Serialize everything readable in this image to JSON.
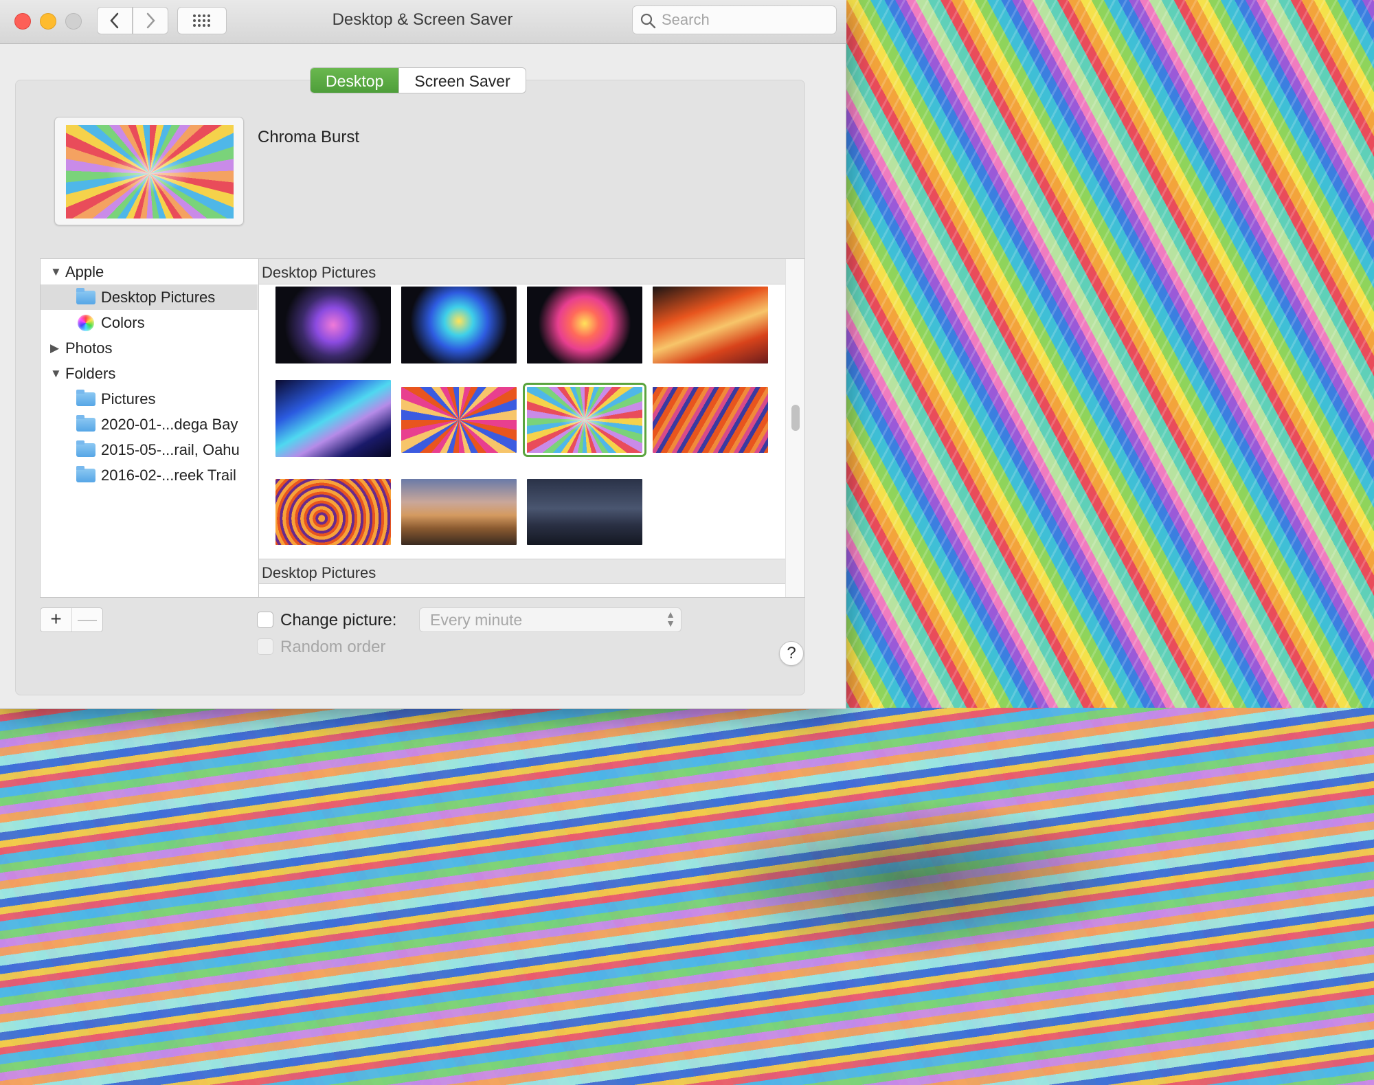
{
  "window": {
    "title": "Desktop & Screen Saver",
    "search": {
      "placeholder": "Search",
      "value": ""
    }
  },
  "tabs": [
    {
      "label": "Desktop",
      "active": true
    },
    {
      "label": "Screen Saver",
      "active": false
    }
  ],
  "preview": {
    "name": "Chroma Burst"
  },
  "sources": [
    {
      "label": "Apple",
      "kind": "group",
      "expanded": true,
      "icon": "disclosure-triangle-open"
    },
    {
      "label": "Desktop Pictures",
      "kind": "item",
      "selected": true,
      "icon": "folder-icon"
    },
    {
      "label": "Colors",
      "kind": "item",
      "icon": "colors-icon"
    },
    {
      "label": "Photos",
      "kind": "group",
      "expanded": false,
      "icon": "disclosure-triangle-closed"
    },
    {
      "label": "Folders",
      "kind": "group",
      "expanded": true,
      "icon": "disclosure-triangle-open"
    },
    {
      "label": "Pictures",
      "kind": "item",
      "icon": "pictures-folder-icon"
    },
    {
      "label": "2020-01-...dega Bay",
      "kind": "item",
      "icon": "folder-icon"
    },
    {
      "label": "2015-05-...rail, Oahu",
      "kind": "item",
      "icon": "folder-icon"
    },
    {
      "label": "2016-02-...reek Trail",
      "kind": "item",
      "icon": "folder-icon"
    }
  ],
  "grid": {
    "sections": [
      {
        "label": "Desktop Pictures"
      },
      {
        "label": "Desktop Pictures"
      }
    ],
    "selected_index": 6
  },
  "options": {
    "change_picture_label": "Change picture:",
    "change_picture_checked": false,
    "interval": "Every minute",
    "random_order_label": "Random order",
    "random_order_checked": false
  },
  "buttons": {
    "add": "+",
    "remove": "—",
    "help": "?"
  },
  "colors": {
    "accent": "#5aa43e",
    "window_bg": "#ececec"
  }
}
